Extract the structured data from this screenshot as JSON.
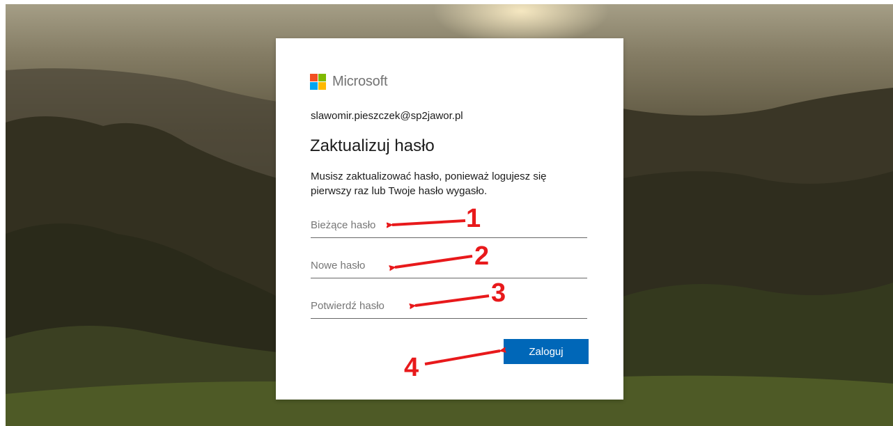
{
  "brand": {
    "name": "Microsoft",
    "colors": [
      "#f25022",
      "#7fba00",
      "#00a4ef",
      "#ffb900"
    ]
  },
  "account": {
    "email": "slawomir.pieszczek@sp2jawor.pl"
  },
  "form": {
    "title": "Zaktualizuj hasło",
    "description": "Musisz zaktualizować hasło, ponieważ logujesz się pierwszy raz lub Twoje hasło wygasło.",
    "current_password_placeholder": "Bieżące hasło",
    "new_password_placeholder": "Nowe hasło",
    "confirm_password_placeholder": "Potwierdź hasło",
    "submit_label": "Zaloguj"
  },
  "annotations": {
    "labels": [
      "1",
      "2",
      "3",
      "4"
    ],
    "color": "#e8191b"
  },
  "theme": {
    "accent": "#0067b8"
  }
}
